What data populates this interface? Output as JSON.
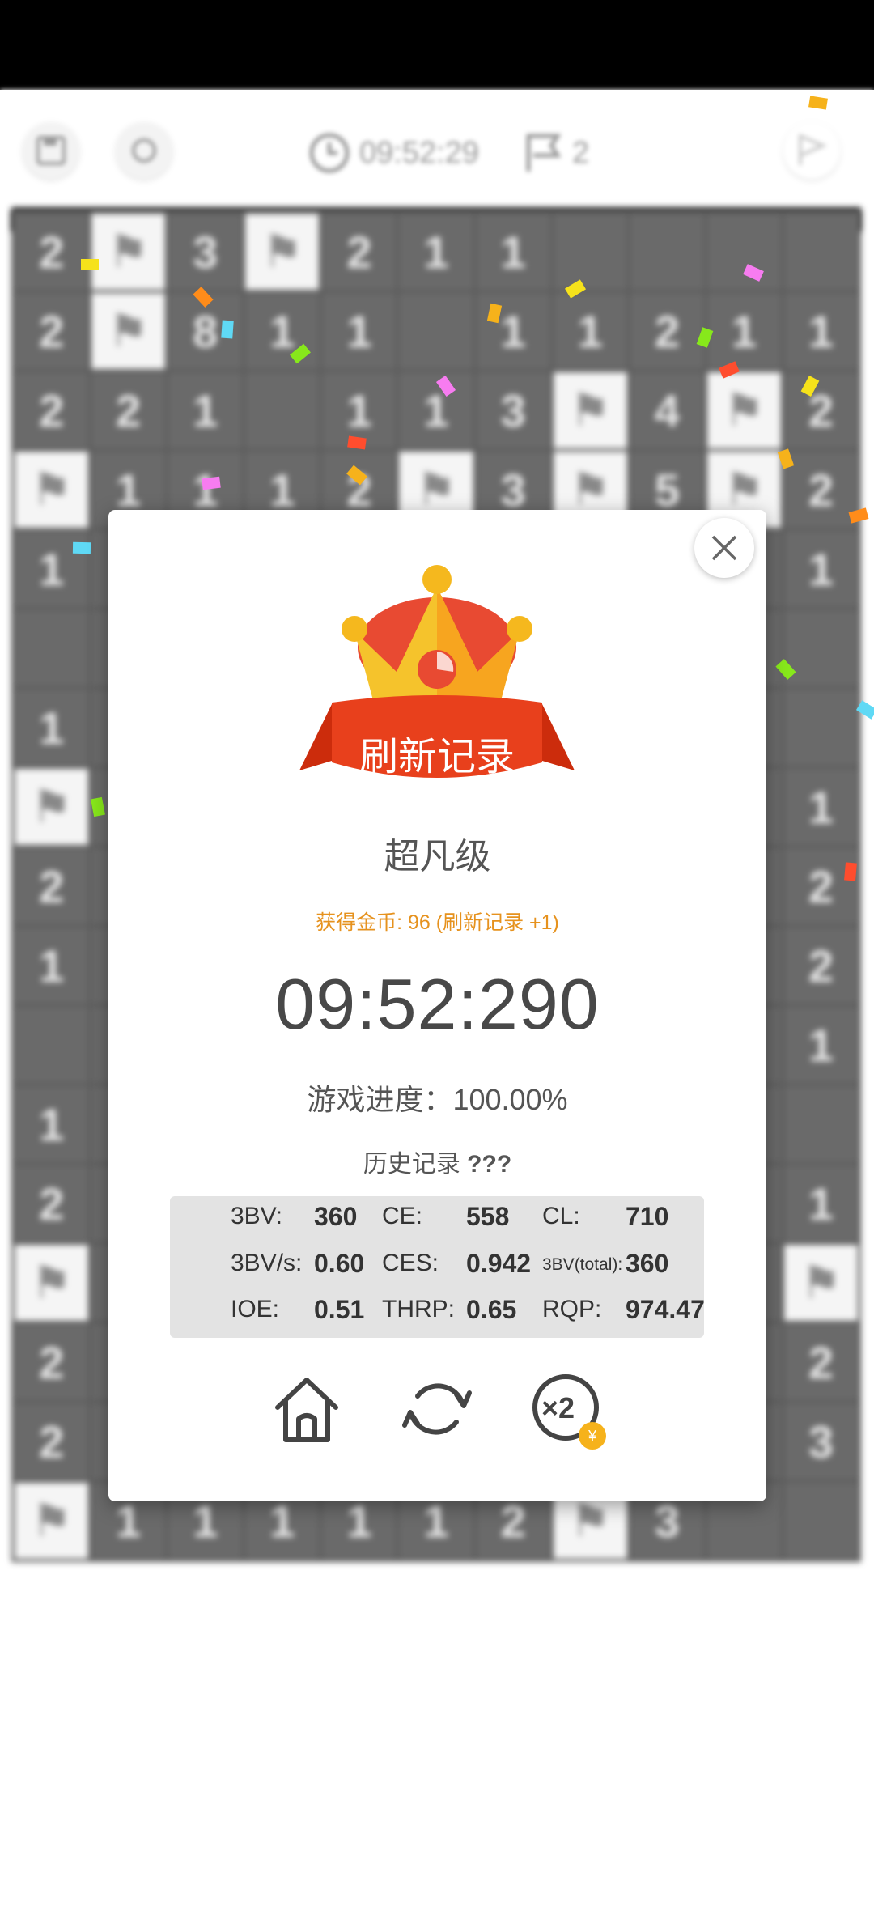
{
  "topbar": {
    "timer": "09:52:29",
    "flags": "2"
  },
  "board": {
    "rows": [
      [
        "2",
        "F",
        "3",
        "F",
        "2",
        "1",
        "1",
        "",
        "",
        "",
        ""
      ],
      [
        "2",
        "F",
        "8",
        "1",
        "1",
        "",
        "1",
        "1",
        "2",
        "1",
        "1"
      ],
      [
        "2",
        "2",
        "1",
        "",
        "1",
        "1",
        "3",
        "F",
        "4",
        "F",
        "2"
      ],
      [
        "F",
        "1",
        "1",
        "1",
        "2",
        "F",
        "3",
        "F",
        "5",
        "F",
        "2"
      ],
      [
        "1",
        "",
        "",
        "",
        "",
        "",
        "",
        "",
        "",
        "",
        "1"
      ],
      [
        "",
        "",
        "",
        "",
        "",
        "",
        "",
        "",
        "",
        "",
        ""
      ],
      [
        "1",
        "",
        "",
        "",
        "",
        "",
        "",
        "",
        "",
        "",
        ""
      ],
      [
        "F",
        "",
        "",
        "",
        "",
        "",
        "",
        "",
        "",
        "",
        "1"
      ],
      [
        "2",
        "",
        "",
        "",
        "",
        "",
        "",
        "",
        "",
        "",
        "2"
      ],
      [
        "1",
        "",
        "",
        "",
        "",
        "",
        "",
        "",
        "",
        "",
        "2"
      ],
      [
        "",
        "",
        "",
        "",
        "",
        "",
        "",
        "",
        "",
        "",
        "1"
      ],
      [
        "1",
        "",
        "",
        "",
        "",
        "",
        "",
        "",
        "",
        "",
        ""
      ],
      [
        "2",
        "",
        "",
        "",
        "",
        "",
        "",
        "",
        "",
        "",
        "1"
      ],
      [
        "F",
        "",
        "",
        "",
        "",
        "",
        "",
        "",
        "",
        "",
        "F"
      ],
      [
        "2",
        "",
        "",
        "",
        "",
        "",
        "",
        "",
        "",
        "",
        "2"
      ],
      [
        "2",
        "",
        "",
        "",
        "",
        "",
        "",
        "",
        "",
        "",
        "3"
      ],
      [
        "F",
        "1",
        "1",
        "1",
        "1",
        "1",
        "2",
        "F",
        "3",
        "",
        ""
      ]
    ]
  },
  "modal": {
    "banner": "刷新记录",
    "rank": "超凡级",
    "coins": "获得金币: 96 (刷新记录 +1)",
    "time": "09:52:290",
    "progress": "游戏进度：100.00%",
    "history_label": "历史记录",
    "history_value": "???",
    "stats": {
      "bv_label": "3BV:",
      "bv": "360",
      "ce_label": "CE:",
      "ce": "558",
      "cl_label": "CL:",
      "cl": "710",
      "bvs_label": "3BV/s:",
      "bvs": "0.60",
      "ces_label": "CES:",
      "ces": "0.942",
      "bvtotal_label": "3BV(total):",
      "bvtotal": "360",
      "ioe_label": "IOE:",
      "ioe": "0.51",
      "thrp_label": "THRP:",
      "thrp": "0.65",
      "rqp_label": "RQP:",
      "rqp": "974.47"
    },
    "double_label": "×2",
    "coin_symbol": "¥"
  },
  "icons": {
    "close": "close-icon",
    "home": "home-icon",
    "restart": "restart-icon",
    "double": "double-reward-icon",
    "crown": "crown-icon"
  },
  "colors": {
    "banner": "#e8401c",
    "crown_left": "#f5c32c",
    "crown_right": "#f7a51f",
    "crown_dome": "#e84a32",
    "coins_text": "#e6921e",
    "coin_badge": "#f6b21b"
  }
}
